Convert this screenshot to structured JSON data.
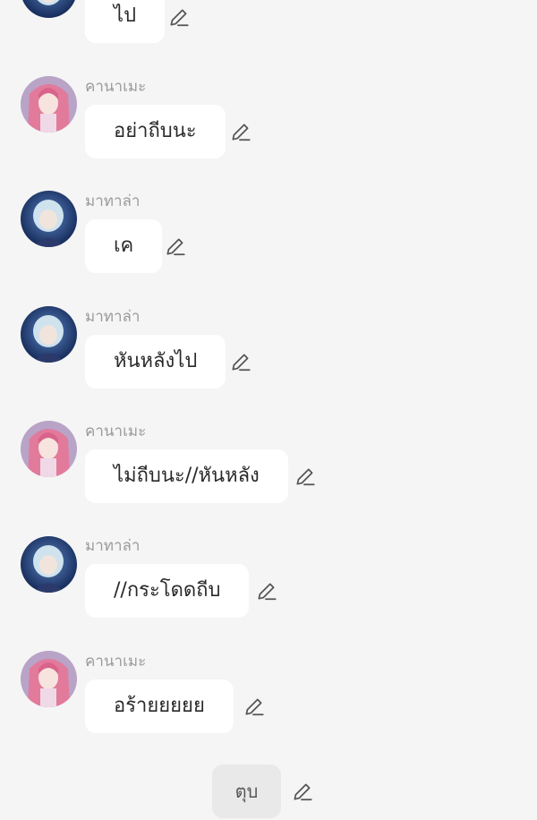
{
  "messages": [
    {
      "sender": "",
      "text": "ไป"
    },
    {
      "sender": "คานาเมะ",
      "text": "อย่าถีบนะ"
    },
    {
      "sender": "มาทาล่า",
      "text": "เค"
    },
    {
      "sender": "มาทาล่า",
      "text": "หันหลังไป"
    },
    {
      "sender": "คานาเมะ",
      "text": "ไม่ถีบนะ//หันหลัง"
    },
    {
      "sender": "มาทาล่า",
      "text": "//กระโดดถีบ"
    },
    {
      "sender": "คานาเมะ",
      "text": "อร้ายยยยย"
    }
  ],
  "action": {
    "label": "ตุบ"
  },
  "colors": {
    "background": "#f5f5f5",
    "bubble": "#ffffff",
    "action_bubble": "#e9e9e9",
    "username": "#9a9a9a",
    "text": "#2a2a2a",
    "icon": "#555555"
  },
  "icons": {
    "edit": "pencil-icon",
    "avatar_kaname": "pink-hair-avatar",
    "avatar_matala": "blue-hair-avatar"
  }
}
